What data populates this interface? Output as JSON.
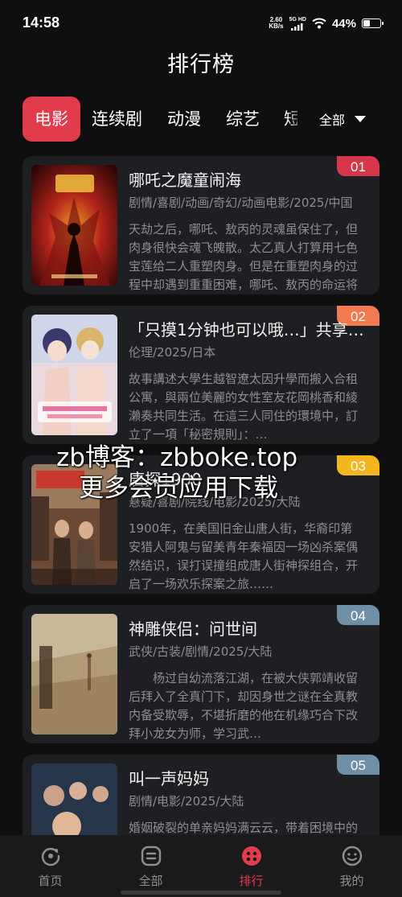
{
  "status": {
    "time": "14:58",
    "speed_value": "2.60",
    "speed_unit": "KB/s",
    "network": "5G HD",
    "battery": "44%",
    "battery_level": 0.44
  },
  "header": {
    "title": "排行榜"
  },
  "categories": {
    "tabs": [
      {
        "label": "电影",
        "active": true
      },
      {
        "label": "连续剧"
      },
      {
        "label": "动漫"
      },
      {
        "label": "综艺"
      },
      {
        "label": "短"
      }
    ],
    "more_label": "全部"
  },
  "colors": {
    "accent": "#e23b4b",
    "rank1": "#d7374a",
    "rank2": "#f17a52",
    "rank3": "#f2b71f",
    "rank_other": "#6e8fa6"
  },
  "items": [
    {
      "rank": "01",
      "title": "哪吒之魔童闹海",
      "tags": "剧情/喜剧/动画/奇幻/动画电影/2025/中国",
      "desc": "天劫之后，哪吒、敖丙的灵魂虽保住了，但肉身很快会魂飞魄散。太乙真人打算用七色宝莲给二人重塑肉身。但是在重塑肉身的过程中却遇到重重困难，哪吒、敖丙的命运将走向何方？"
    },
    {
      "rank": "02",
      "title": "「只摸1分钟也可以哦…」共享…",
      "tags": "伦理/2025/日本",
      "desc": "故事講述大學生越智遼太因升學而搬入合租公寓，與兩位美麗的女性室友花岡桃香和綾瀨奏共同生活。在這三人同住的環境中，訂立了一項「秘密規則」：…"
    },
    {
      "rank": "03",
      "title": "唐探1900",
      "tags": "悬疑/喜剧/院线/电影/2025/大陆",
      "desc": "1900年，在美国旧金山唐人街，华裔印第安猎人阿鬼与留美青年秦福因一场凶杀案偶然结识，误打误撞组成唐人街神探组合，开启了一场欢乐探案之旅……"
    },
    {
      "rank": "04",
      "title": "神雕侠侣：问世间",
      "tags": "武侠/古装/剧情/2025/大陆",
      "desc": "　　杨过自幼流落江湖，在被大侠郭靖收留后拜入了全真门下，却因身世之谜在全真教内备受欺辱，不堪折磨的他在机缘巧合下改拜小龙女为师，学习武…"
    },
    {
      "rank": "05",
      "title": "叫一声妈妈",
      "tags": "剧情/电影/2025/大陆",
      "desc": "婚姻破裂的单亲妈妈满云云，带着困境中的女儿艰难生活……"
    }
  ],
  "watermark": {
    "line1": "zb博客：zbboke.top",
    "line2": "更多会员应用下载"
  },
  "nav": [
    {
      "label": "首页",
      "icon": "home-icon"
    },
    {
      "label": "全部",
      "icon": "list-icon"
    },
    {
      "label": "排行",
      "icon": "ranking-icon",
      "active": true
    },
    {
      "label": "我的",
      "icon": "profile-icon"
    }
  ]
}
